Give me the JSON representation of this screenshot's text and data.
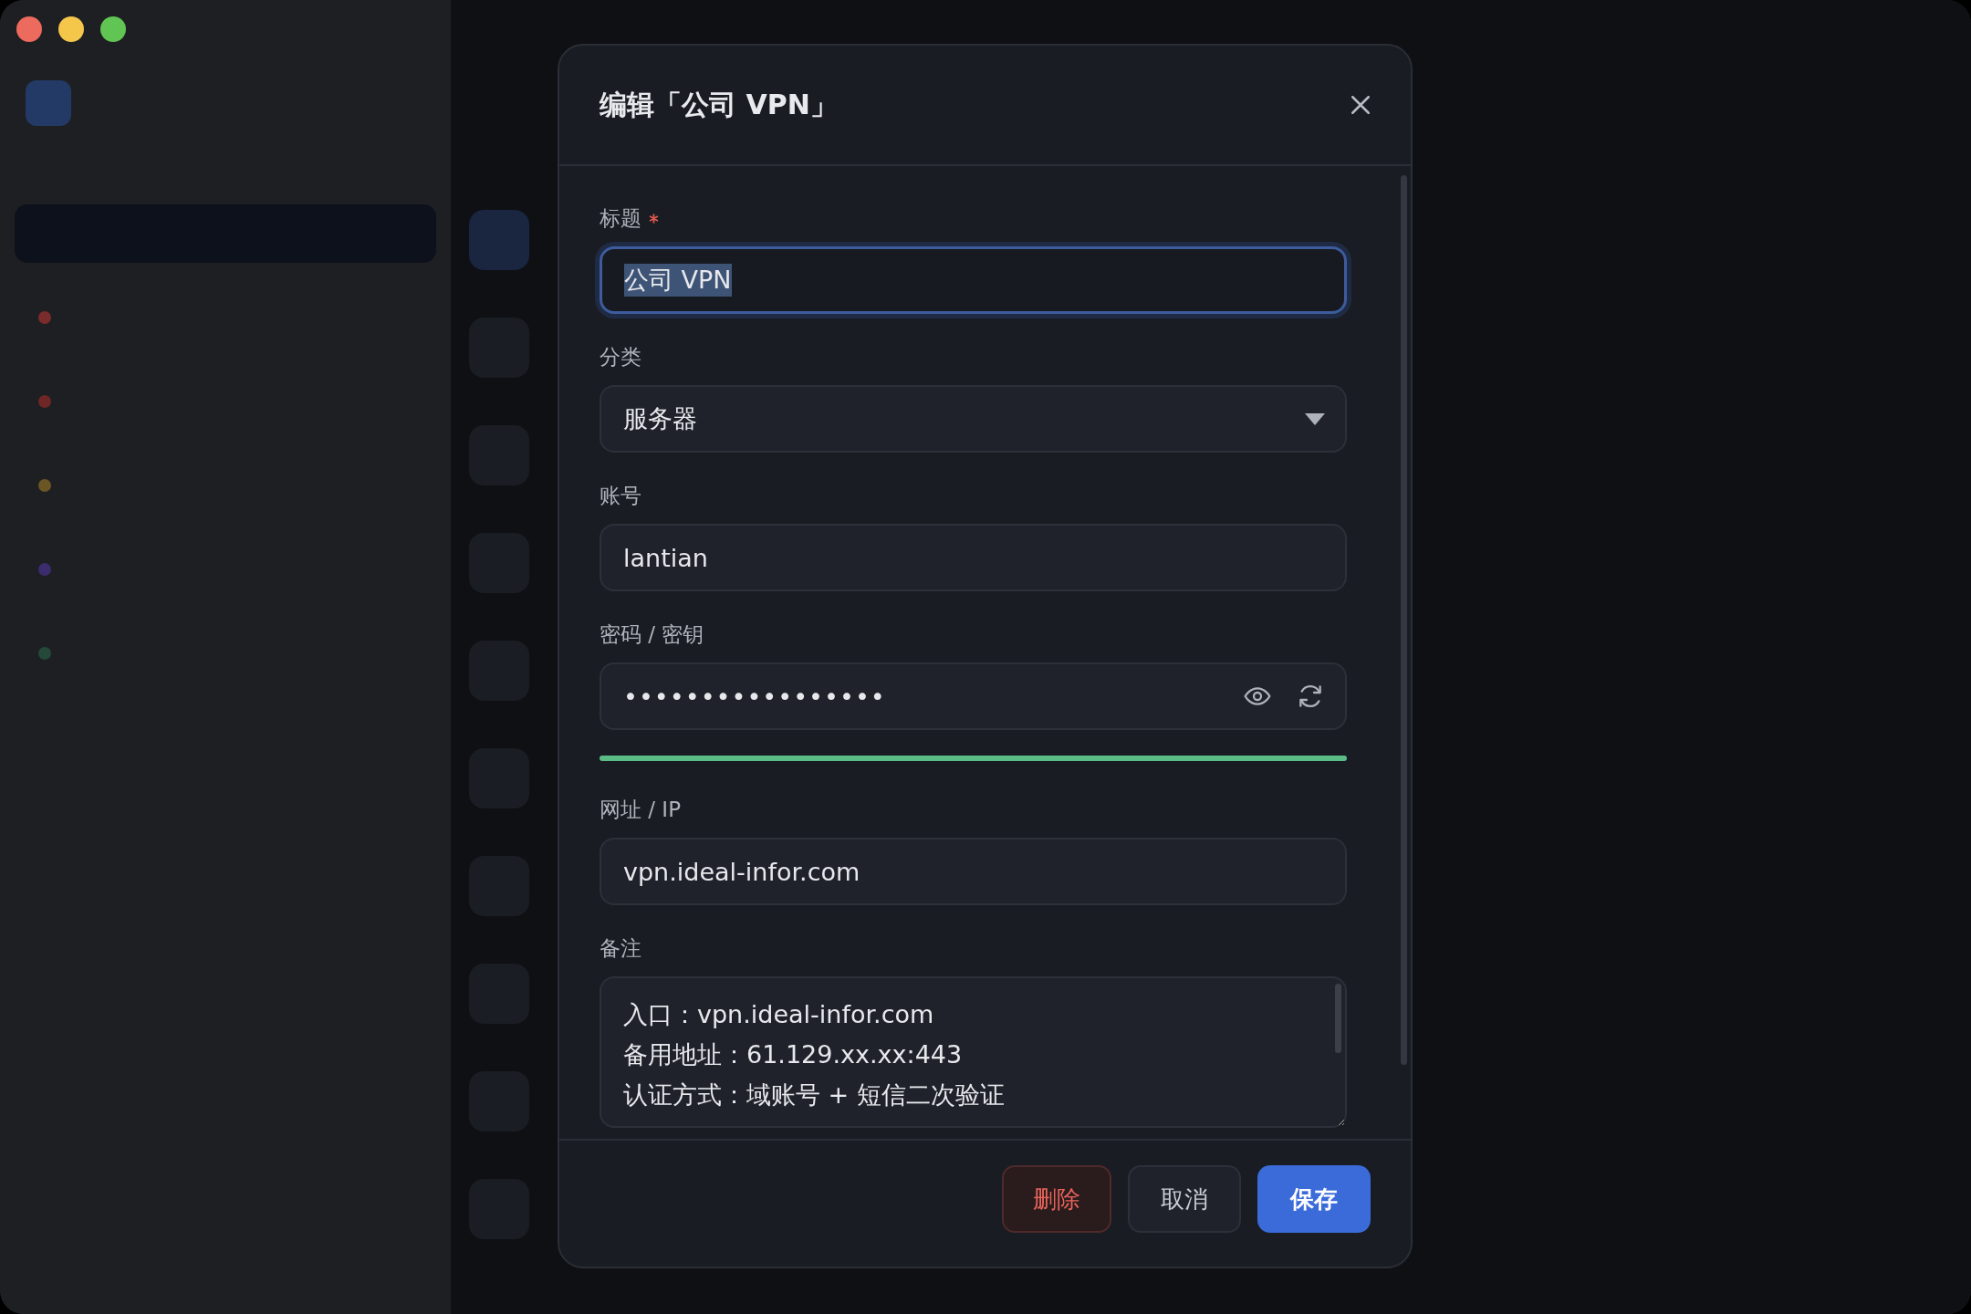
{
  "window": {
    "controls": [
      {
        "color": "#ec6a5e"
      },
      {
        "color": "#f4c64a"
      },
      {
        "color": "#61c554"
      }
    ]
  },
  "sidebar": {
    "items": [
      {
        "selected": true
      },
      {
        "selected": false,
        "color": "#7a2b2b"
      },
      {
        "selected": false,
        "color": "#6e2626"
      },
      {
        "selected": false,
        "color": "#6a5524"
      },
      {
        "selected": false,
        "color": "#3b2c6e"
      },
      {
        "selected": false,
        "color": "#24483a"
      }
    ]
  },
  "dialog": {
    "title": "编辑「公司 VPN」",
    "fields": [
      {
        "kind": "text",
        "label": "标题",
        "required": true,
        "value": "公司 VPN",
        "focused": true,
        "text_selected": true
      },
      {
        "kind": "select",
        "label": "分类",
        "value": "服务器"
      },
      {
        "kind": "text",
        "label": "账号",
        "value": "lantian"
      },
      {
        "kind": "password",
        "label": "密码 / 密钥",
        "value": "•••••••••••••••••",
        "level": 1
      },
      {
        "kind": "text",
        "label": "网址 / IP",
        "value": "vpn.ideal-infor.com"
      },
      {
        "kind": "textarea",
        "label": "备注",
        "value": "入口：vpn.ideal-infor.com\n备用地址：61.129.xx.xx:443\n认证方式：域账号 + 短信二次验证"
      }
    ],
    "buttons": [
      {
        "kind": "danger",
        "label": "删除"
      },
      {
        "kind": "secondary",
        "label": "取消"
      },
      {
        "kind": "primary",
        "label": "保存"
      }
    ]
  }
}
